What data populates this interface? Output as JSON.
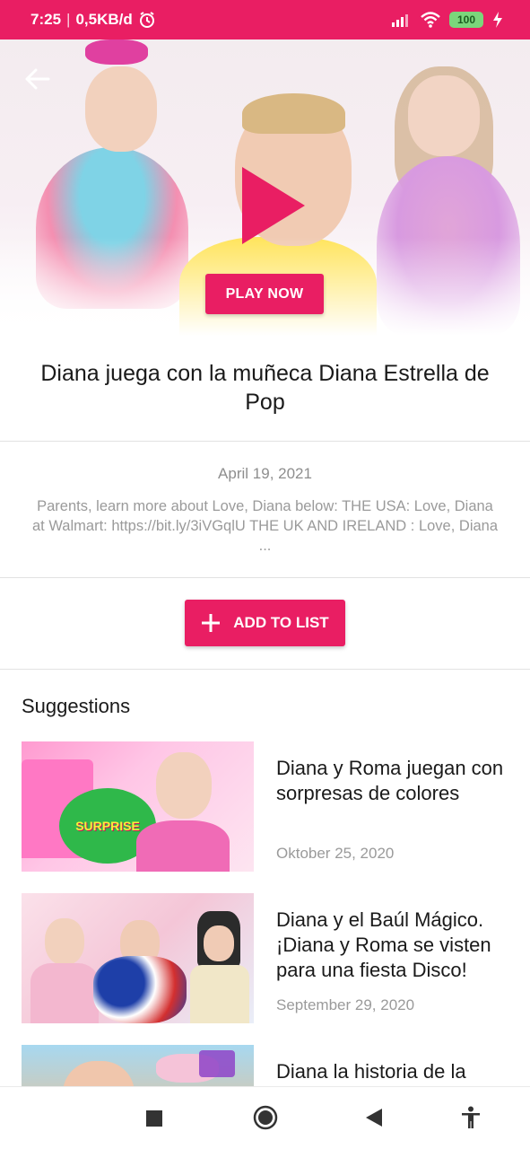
{
  "status_bar": {
    "time": "7:25",
    "network_speed": "0,5KB/d",
    "battery_level": "100",
    "icons": [
      "alarm-icon",
      "signal-icon",
      "wifi-icon",
      "battery-icon",
      "charging-icon"
    ]
  },
  "hero": {
    "play_now_label": "PLAY NOW"
  },
  "video": {
    "title": "Diana juega con la muñeca Diana Estrella de Pop",
    "date": "April 19, 2021",
    "description": "Parents, learn more about Love, Diana below: THE USA: Love, Diana at Walmart: https://bit.ly/3iVGqlU THE UK AND IRELAND : Love, Diana ..."
  },
  "actions": {
    "add_to_list_label": "ADD TO LIST"
  },
  "suggestions": {
    "heading": "Suggestions",
    "items": [
      {
        "title": "Diana y Roma juegan con sorpresas de colores",
        "date": "Oktober 25, 2020",
        "thumb_text": "SURPRISE"
      },
      {
        "title": "Diana y el Baúl Mágico. ¡Diana y Roma se visten para una fiesta Disco!",
        "date": "September 29, 2020"
      },
      {
        "title": "Diana la historia de la",
        "date": ""
      }
    ]
  },
  "colors": {
    "accent": "#e91e63",
    "muted_text": "#9a9a9a"
  },
  "nav_bar": {
    "icons": [
      "recents-square-icon",
      "home-circle-icon",
      "back-triangle-icon",
      "accessibility-icon"
    ]
  }
}
